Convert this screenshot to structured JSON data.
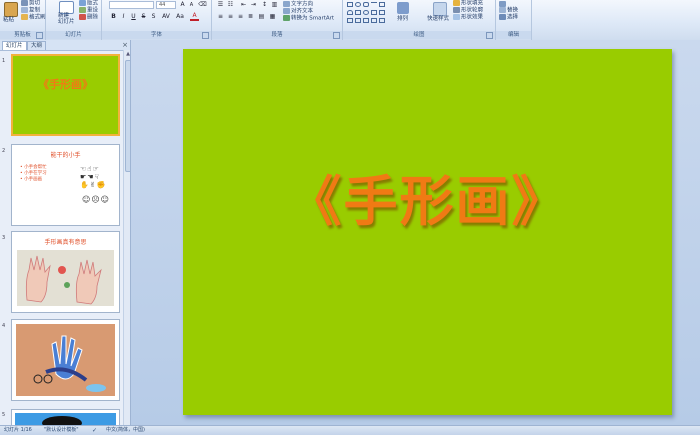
{
  "ribbon": {
    "clipboard": {
      "label": "剪贴板",
      "paste": "粘贴",
      "cut": "剪切",
      "copy": "复制",
      "format_painter": "格式刷"
    },
    "slides": {
      "label": "幻灯片",
      "new_slide": "新建\n幻灯片",
      "layout": "版式",
      "reset": "重设",
      "delete": "删除"
    },
    "font": {
      "label": "字体",
      "font_name": "",
      "font_size": "44",
      "bold": "B",
      "italic": "I",
      "underline": "U",
      "strike": "S",
      "shadow": "S",
      "spacing": "AV",
      "case": "Aa",
      "color": "A"
    },
    "paragraph": {
      "label": "段落",
      "align_text": "对齐文本",
      "convert_smartart": "转换为 SmartArt"
    },
    "drawing": {
      "label": "绘图",
      "arrange": "排列",
      "quick_styles": "快速样式",
      "shape_fill": "形状填充",
      "shape_outline": "形状轮廓",
      "shape_effects": "形状效果"
    },
    "editing": {
      "label": "编辑",
      "replace": "替换",
      "select": "选择"
    }
  },
  "pane": {
    "tab_slides": "幻灯片",
    "tab_outline": "大纲",
    "close": "×",
    "thumbnails": [
      {
        "num": "1",
        "title": "《手形画》"
      },
      {
        "num": "2",
        "title": "能干的小手",
        "bullets": [
          "小手会帮忙",
          "小手在学习",
          "小手画画"
        ]
      },
      {
        "num": "3",
        "title": "手形画真有意思"
      },
      {
        "num": "4",
        "title": ""
      },
      {
        "num": "5",
        "title": ""
      }
    ]
  },
  "slide": {
    "title": "《手形画》",
    "background": "#99cc00",
    "title_color": "#f07a14"
  },
  "status": {
    "slide_counter": "幻灯片 1/16",
    "theme": "\"默认设计模板\"",
    "language": "中文(简体，中国)"
  }
}
